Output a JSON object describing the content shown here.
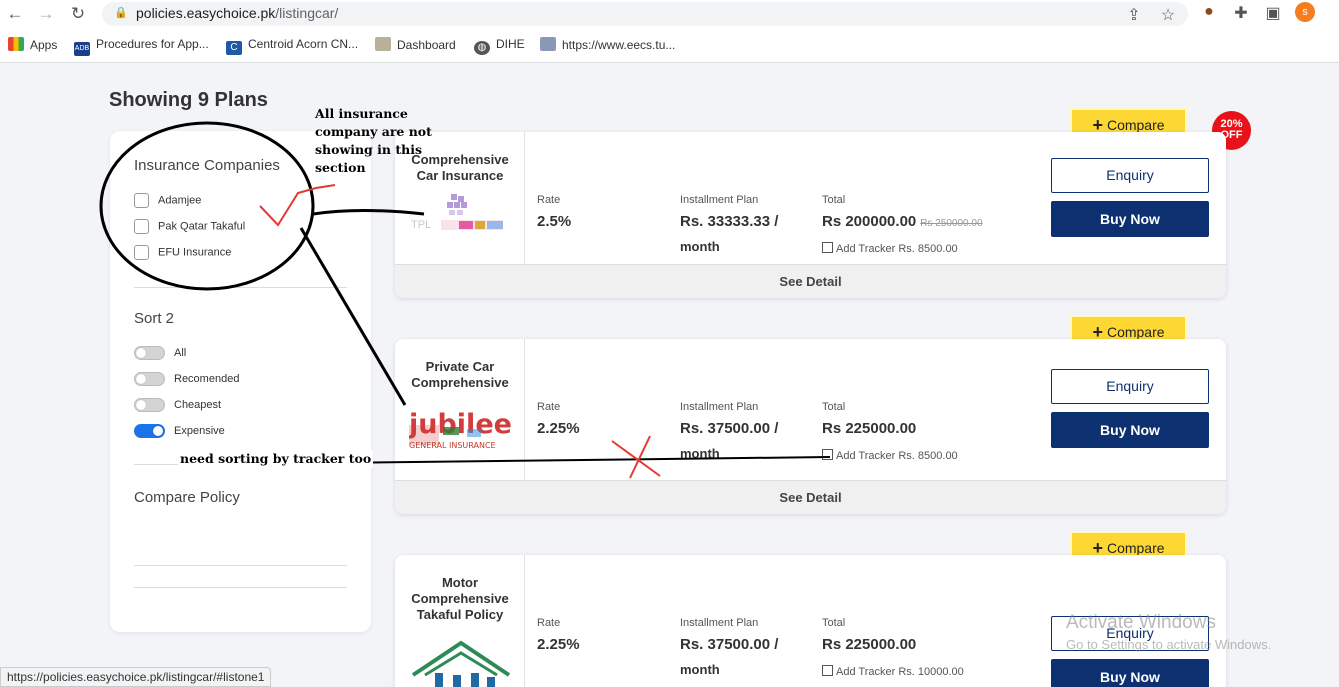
{
  "browser": {
    "back_icon": "←",
    "forward_icon": "→",
    "reload_icon": "↻",
    "url_host": "policies.easychoice.pk",
    "url_path": "/listingcar/",
    "profile_initial": "s",
    "bookmarks": [
      {
        "label": "Apps"
      },
      {
        "label": "Procedures for App..."
      },
      {
        "label": "Centroid Acorn CN..."
      },
      {
        "label": "Dashboard"
      },
      {
        "label": "DIHE"
      },
      {
        "label": "https://www.eecs.tu..."
      }
    ]
  },
  "page": {
    "heading": "Showing 9 Plans"
  },
  "sidebar": {
    "companies_title": "Insurance Companies",
    "companies": [
      {
        "label": "Adamjee",
        "checked": false
      },
      {
        "label": "Pak Qatar Takaful",
        "checked": false
      },
      {
        "label": "EFU Insurance",
        "checked": false
      }
    ],
    "sort_title": "Sort 2",
    "sort_options": [
      {
        "label": "All",
        "on": false
      },
      {
        "label": "Recomended",
        "on": false
      },
      {
        "label": "Cheapest",
        "on": false
      },
      {
        "label": "Expensive",
        "on": true
      }
    ],
    "compare_title": "Compare Policy"
  },
  "labels": {
    "rate": "Rate",
    "installment": "Installment Plan",
    "total": "Total",
    "enquiry": "Enquiry",
    "buy_now": "Buy Now",
    "see_detail": "See Detail",
    "compare": "Compare",
    "compare_plus": "+"
  },
  "discount_badge": {
    "line1": "20%",
    "line2": "OFF"
  },
  "plans": [
    {
      "name": "Comprehensive Car Insurance",
      "logo": "TPL Insurance",
      "rate": "2.5%",
      "installment": "Rs. 33333.33 /",
      "installment_unit": "month",
      "total": "Rs 200000.00",
      "total_old": "Rs 250000.00",
      "tracker": "Add Tracker Rs. 8500.00"
    },
    {
      "name": "Private Car Comprehensive",
      "logo": "Jubilee General Insurance",
      "logo_text": "jubilee",
      "logo_sub": "GENERAL INSURANCE",
      "rate": "2.25%",
      "installment": "Rs. 37500.00 /",
      "installment_unit": "month",
      "total": "Rs 225000.00",
      "tracker": "Add Tracker Rs. 8500.00"
    },
    {
      "name": "Motor Comprehensive Takaful Policy",
      "logo": "Takaful",
      "rate": "2.25%",
      "installment": "Rs. 37500.00 /",
      "installment_unit": "month",
      "total": "Rs 225000.00",
      "tracker": "Add Tracker Rs. 10000.00"
    }
  ],
  "annotations": {
    "note1": "All insurance company are not showing in this section",
    "note2": "need sorting by tracker too"
  },
  "watermark": {
    "line1": "Activate Windows",
    "line2": "Go to Settings to activate Windows."
  },
  "status_url": "https://policies.easychoice.pk/listingcar/#listone1"
}
